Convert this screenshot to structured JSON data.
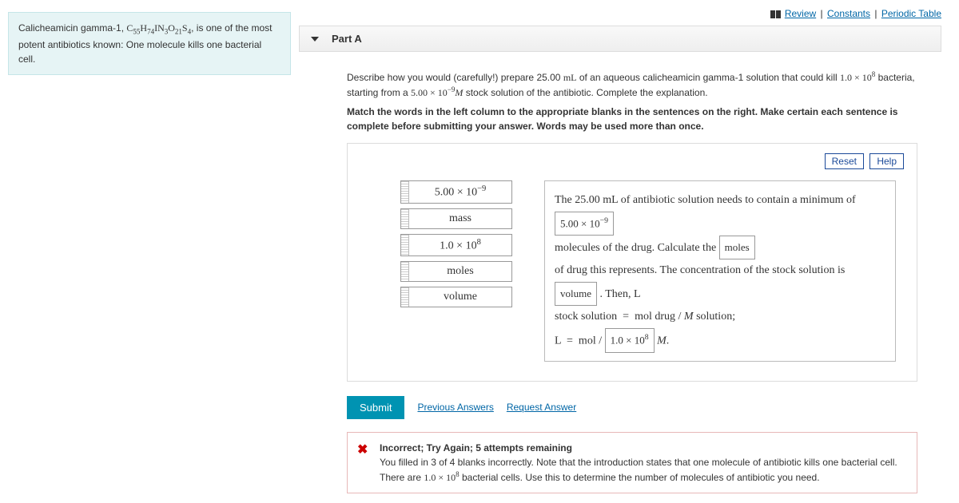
{
  "top": {
    "review": "Review",
    "constants": "Constants",
    "periodic": "Periodic Table"
  },
  "info": {
    "text_pre": "Calicheamicin gamma-1, ",
    "formula_html": "C₅₅H₇₄IN₃O₂₁S₄",
    "text_post": ", is one of the most potent antibiotics known: One molecule kills one bacterial cell."
  },
  "part": {
    "label": "Part A"
  },
  "prompt": {
    "p1_a": "Describe how you would (carefully!) prepare 25.00 ",
    "p1_mL": "mL",
    "p1_b": " of an aqueous calicheamicin gamma-1 solution that could kill ",
    "p1_num": "1.0 × 10⁸",
    "p1_c": " bacteria, starting from a ",
    "p1_conc": "5.00 × 10⁻⁹",
    "p1_M": "M",
    "p1_d": " stock solution of the antibiotic. Complete the explanation."
  },
  "instruct": "Match the words in the left column to the appropriate blanks in the sentences on the right. Make certain each sentence is complete before submitting your answer. Words may be used more than once.",
  "controls": {
    "reset": "Reset",
    "help": "Help"
  },
  "tokens": {
    "t1": "5.00 × 10⁻⁹",
    "t2": "mass",
    "t3": "1.0 × 10⁸",
    "t4": "moles",
    "t5": "volume"
  },
  "sentence": {
    "s1a": "The 25.00 ",
    "s1mL": "mL",
    "s1b": " of antibiotic solution needs to contain a minimum of ",
    "blank1": "5.00 × 10⁻⁹",
    "s2a": "molecules of the drug. Calculate the ",
    "blank2": "moles",
    "s3a": "of drug this represents. The concentration of the stock solution is ",
    "blank3": "volume",
    "s3b": " . Then, ",
    "s3L": "L",
    "s4a": "stock solution  =  mol drug / ",
    "s4M": "M",
    "s4b": " solution;",
    "s5a": "L  =  mol / ",
    "blank4": "1.0 × 10⁸",
    "s5M": " M",
    "s5b": "."
  },
  "actions": {
    "submit": "Submit",
    "prev": "Previous Answers",
    "req": "Request Answer"
  },
  "feedback": {
    "title": "Incorrect; Try Again; 5 attempts remaining",
    "body1": "You filled in 3 of 4 blanks incorrectly. Note that the introduction states that one molecule of antibiotic kills one bacterial cell. There are ",
    "body_num": "1.0 × 10⁸",
    "body2": " bacterial cells. Use this to determine the number of molecules of antibiotic you need."
  }
}
